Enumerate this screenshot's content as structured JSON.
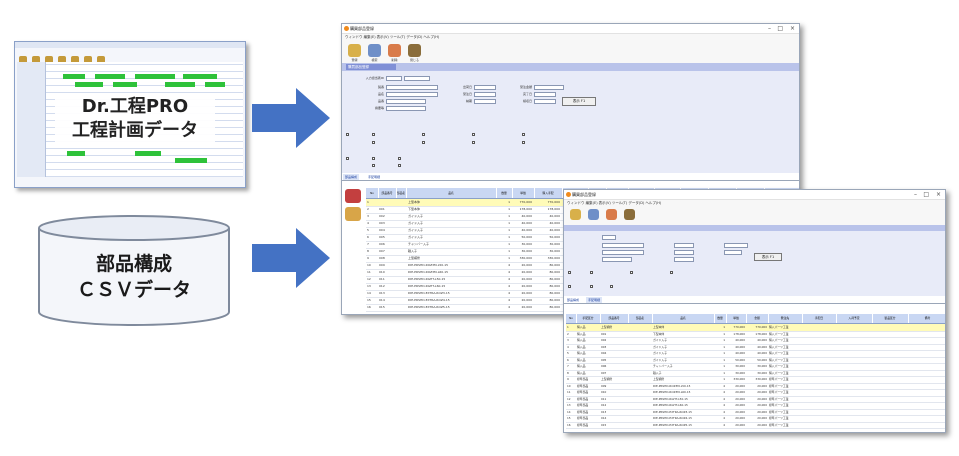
{
  "thumbnail": {
    "caption_line1": "Dr.工程PRO",
    "caption_line2": "工程計画データ"
  },
  "database": {
    "label_line1": "部品構成",
    "label_line2": "ＣＳＶデータ"
  },
  "colors": {
    "arrow": "#4472c4",
    "db_top": "#e9edf5",
    "db_body": "#f4f6fa",
    "db_stroke": "#7f8a9c",
    "gantt_bar": "#2ec23a",
    "header_band": "#b9c3ea",
    "selected_row": "#fffbb8"
  },
  "window_main": {
    "title": "購買部品登録",
    "menu": "ウィンドウ  編集(E)  表示(V)  ツール(T)  データ(D)  ヘルプ(H)",
    "toolbar": [
      "登録",
      "検索",
      "削除",
      "閉じる"
    ],
    "header_label": "購買部品登録",
    "field_labels": [
      "入力担当者ID",
      "製番",
      "品名",
      "品番",
      "摘要等",
      "出荷日",
      "受注日",
      "納期",
      "受注金額",
      "完了日",
      "検収日"
    ],
    "field_values": [
      "0000",
      "1-20E-20190D1",
      "ACE型",
      "",
      "",
      "",
      "2021/03/04",
      "2021/03/22",
      "1,000,000",
      "",
      ""
    ],
    "button_show": "表示 F1",
    "tabs": [
      "部品構成",
      "手配明細"
    ],
    "column_headers": [
      "部品番号",
      "部品名",
      "品名",
      "数量",
      "単価",
      "購入手配",
      "購入予定金額",
      "手配済",
      "手配日",
      "発注先",
      "入荷予定",
      "購入業者",
      "購入金額",
      "製品",
      "完了"
    ],
    "rows": [
      {
        "no": "1",
        "code": "",
        "name": "上型本体",
        "qty": "1",
        "price": "770,000",
        "amt": "770,000",
        "unit": "set"
      },
      {
        "no": "2",
        "code": "001",
        "name": "下型本体",
        "qty": "1",
        "price": "178,000",
        "amt": "178,000",
        "unit": "set"
      },
      {
        "no": "3",
        "code": "002",
        "name": "ガイド入子",
        "qty": "1",
        "price": "40,000",
        "amt": "40,000",
        "unit": "set"
      },
      {
        "no": "4",
        "code": "003",
        "name": "ガイド入子",
        "qty": "1",
        "price": "40,000",
        "amt": "40,000",
        "unit": "set"
      },
      {
        "no": "5",
        "code": "004",
        "name": "ガイド入子",
        "qty": "1",
        "price": "40,000",
        "amt": "40,000",
        "unit": "set"
      },
      {
        "no": "6",
        "code": "005",
        "name": "ガイド入子",
        "qty": "1",
        "price": "50,000",
        "amt": "50,000",
        "unit": "set"
      },
      {
        "no": "7",
        "code": "006",
        "name": "チャンバー入子",
        "qty": "1",
        "price": "30,000",
        "amt": "30,000",
        "unit": "set"
      },
      {
        "no": "8",
        "code": "007",
        "name": "職入子",
        "qty": "1",
        "price": "30,000",
        "amt": "30,000",
        "unit": "set"
      },
      {
        "no": "9",
        "code": "008",
        "name": "上型補修",
        "qty": "1",
        "price": "330,000",
        "amt": "330,000",
        "unit": "set"
      },
      {
        "no": "10",
        "code": "009",
        "name": "DIE-PRSHD-ROZ3M-L50-15",
        "qty": "4",
        "price": "20,000",
        "amt": "80,000",
        "unit": "set"
      },
      {
        "no": "11",
        "code": "010",
        "name": "DIE-PRSHD-ROZ3M-L60-15",
        "qty": "4",
        "price": "20,000",
        "amt": "80,000",
        "unit": "set"
      },
      {
        "no": "12",
        "code": "011",
        "name": "DIE-PRSHD-RGHT-L50-15",
        "qty": "4",
        "price": "20,000",
        "amt": "80,000",
        "unit": "set"
      },
      {
        "no": "13",
        "code": "012",
        "name": "DIE-PRSHD-RGHT-L60-15",
        "qty": "4",
        "price": "20,000",
        "amt": "80,000",
        "unit": "set"
      },
      {
        "no": "14",
        "code": "013",
        "name": "DIE-PRSHD-EXTRA-ROZ3-15",
        "qty": "4",
        "price": "20,000",
        "amt": "80,000",
        "unit": "set"
      },
      {
        "no": "15",
        "code": "014",
        "name": "DIE-PRSHD-EXTRA-ROZ4-15",
        "qty": "4",
        "price": "20,000",
        "amt": "80,000",
        "unit": "set"
      },
      {
        "no": "16",
        "code": "015",
        "name": "DIE-PRSHD-EXTRA-ROZ5-15",
        "qty": "4",
        "price": "20,000",
        "amt": "80,000",
        "unit": "set"
      }
    ]
  },
  "window_sub": {
    "title": "購買部品登録",
    "menu": "ウィンドウ  編集(E)  表示(V)  ツール(T)  データ(D)  ヘルプ(H)",
    "toolbar": [
      "登録",
      "検索",
      "削除",
      "閉じる"
    ],
    "button_show": "表示 F1",
    "tabs": [
      "部品構成",
      "手配明細"
    ],
    "column_headers": [
      "手配区分",
      "部品番号",
      "部品名",
      "品名",
      "数量",
      "単価",
      "金額",
      "発注先",
      "手配日",
      "入荷予定",
      "製品区分",
      "備考"
    ],
    "rows": [
      {
        "no": "1",
        "kind": "購入品",
        "code": "上型補修",
        "name": "上型本体",
        "qty": "1",
        "price": "770,000",
        "extra": "購入パーツ工業"
      },
      {
        "no": "2",
        "kind": "購入品",
        "code": "001",
        "name": "下型本体",
        "qty": "1",
        "price": "178,000",
        "extra": "購入パーツ工業"
      },
      {
        "no": "3",
        "kind": "購入品",
        "code": "002",
        "name": "ガイド入子",
        "qty": "1",
        "price": "40,000",
        "extra": "購入パーツ工業"
      },
      {
        "no": "4",
        "kind": "購入品",
        "code": "003",
        "name": "ガイド入子",
        "qty": "1",
        "price": "40,000",
        "extra": "購入パーツ工業"
      },
      {
        "no": "5",
        "kind": "購入品",
        "code": "004",
        "name": "ガイド入子",
        "qty": "1",
        "price": "40,000",
        "extra": "購入パーツ工業"
      },
      {
        "no": "6",
        "kind": "購入品",
        "code": "005",
        "name": "ガイド入子",
        "qty": "1",
        "price": "50,000",
        "extra": "購入パーツ工業"
      },
      {
        "no": "7",
        "kind": "購入品",
        "code": "006",
        "name": "チャンバー入子",
        "qty": "1",
        "price": "30,000",
        "extra": "購入パーツ工業"
      },
      {
        "no": "8",
        "kind": "購入品",
        "code": "007",
        "name": "職入子",
        "qty": "1",
        "price": "30,000",
        "extra": "購入パーツ工業"
      },
      {
        "no": "9",
        "kind": "標準部品",
        "code": "上型補修",
        "name": "上型補修",
        "qty": "1",
        "price": "330,000",
        "extra": "標準パーツ工業"
      },
      {
        "no": "10",
        "kind": "標準部品",
        "code": "009",
        "name": "DIE-PRSHD-ROZ3M-L50-15",
        "qty": "4",
        "price": "20,000",
        "extra": "標準パーツ工業"
      },
      {
        "no": "11",
        "kind": "標準部品",
        "code": "010",
        "name": "DIE-PRSHD-ROZ3M-L60-15",
        "qty": "4",
        "price": "20,000",
        "extra": "標準パーツ工業"
      },
      {
        "no": "12",
        "kind": "標準部品",
        "code": "011",
        "name": "DIE-PRSHD-RGHT-L50-15",
        "qty": "4",
        "price": "20,000",
        "extra": "標準パーツ工業"
      },
      {
        "no": "13",
        "kind": "標準部品",
        "code": "012",
        "name": "DIE-PRSHD-RGHT-L60-15",
        "qty": "4",
        "price": "20,000",
        "extra": "標準パーツ工業"
      },
      {
        "no": "14",
        "kind": "標準部品",
        "code": "013",
        "name": "DIE-PRSHD-EXTRA-ROZ3-15",
        "qty": "4",
        "price": "20,000",
        "extra": "標準パーツ工業"
      },
      {
        "no": "15",
        "kind": "標準部品",
        "code": "014",
        "name": "DIE-PRSHD-EXTRA-ROZ4-15",
        "qty": "4",
        "price": "20,000",
        "extra": "標準パーツ工業"
      },
      {
        "no": "16",
        "kind": "標準部品",
        "code": "015",
        "name": "DIE-PRSHD-EXTRA-ROZ5-15",
        "qty": "4",
        "price": "20,000",
        "extra": "標準パーツ工業"
      }
    ]
  }
}
